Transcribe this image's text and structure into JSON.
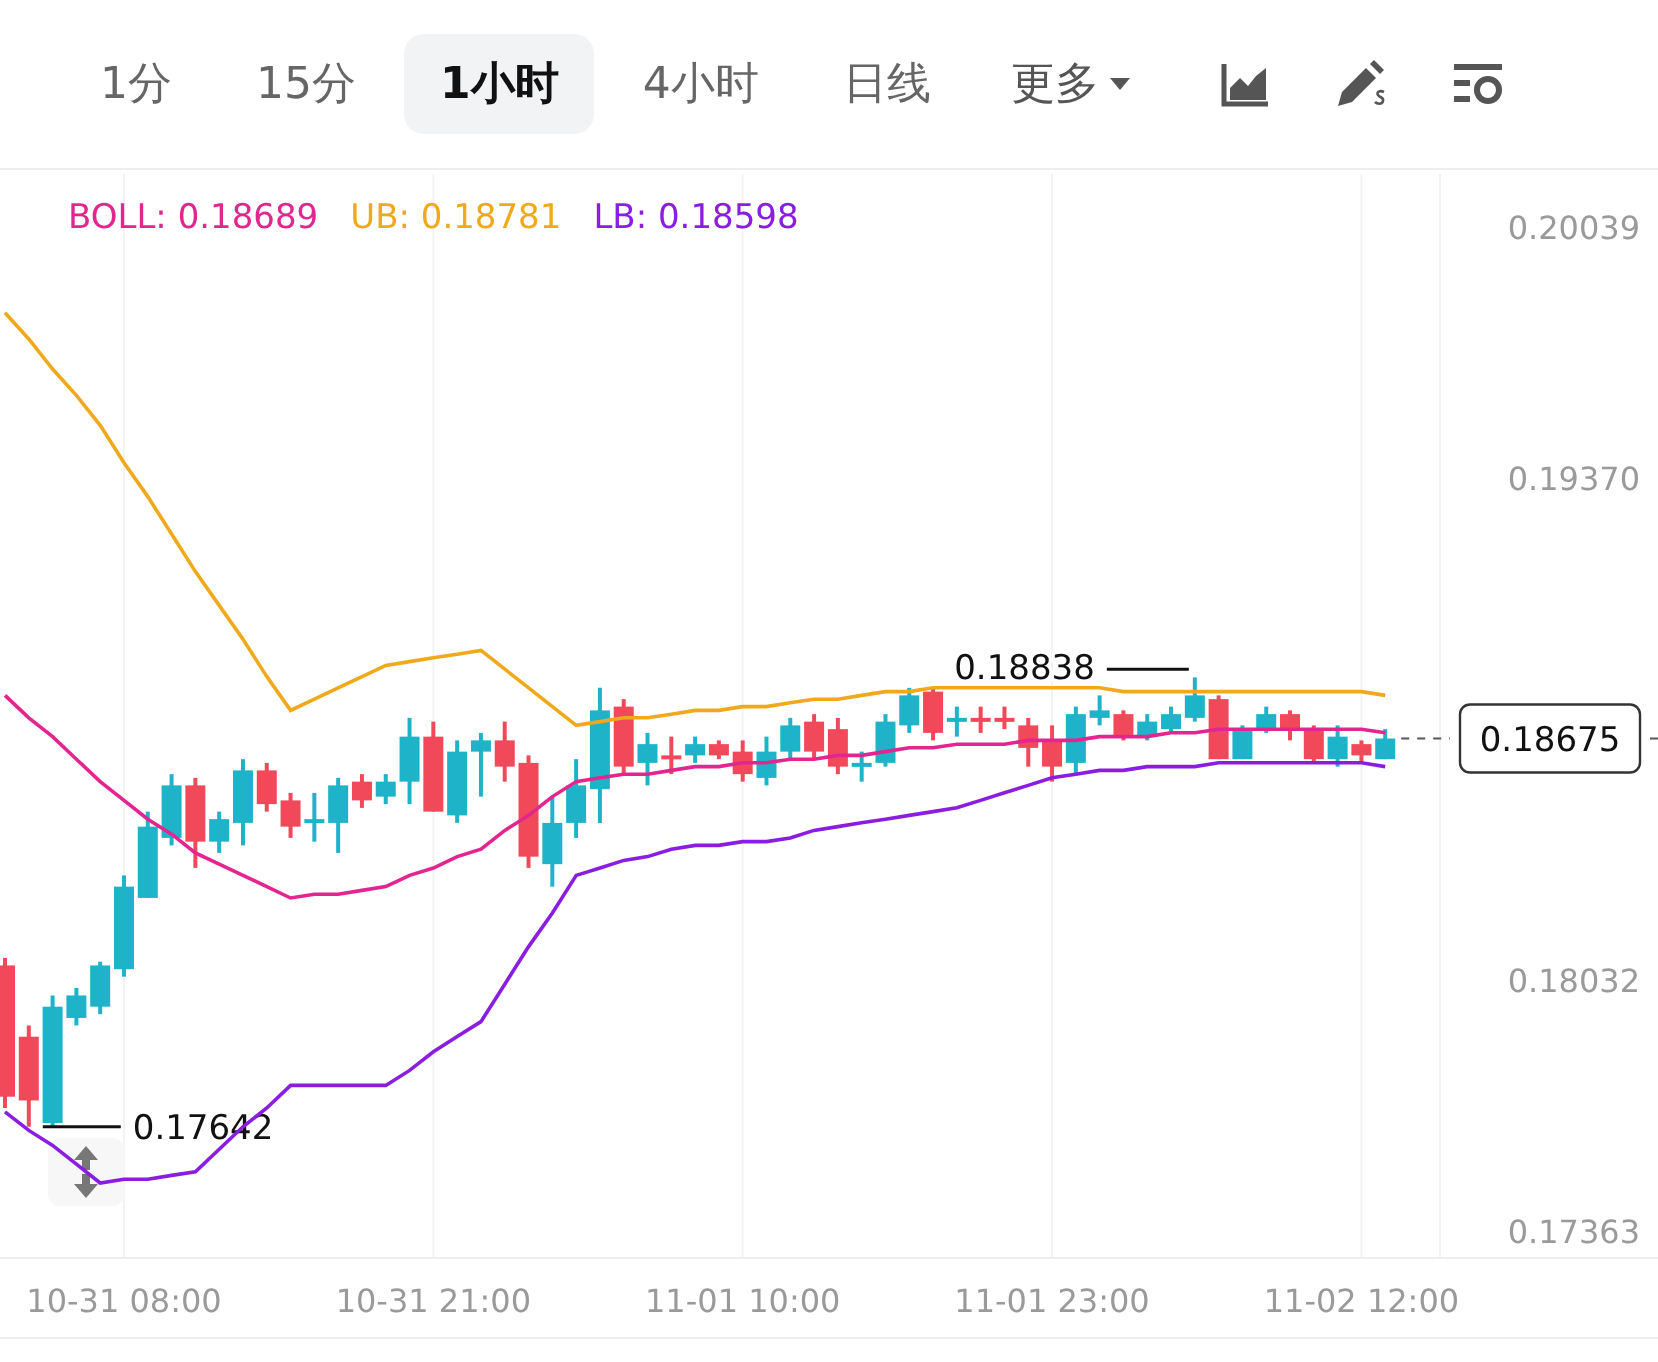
{
  "tabs": [
    {
      "label": "1分",
      "selected": false
    },
    {
      "label": "15分",
      "selected": false
    },
    {
      "label": "1小时",
      "selected": true
    },
    {
      "label": "4小时",
      "selected": false
    },
    {
      "label": "日线",
      "selected": false
    }
  ],
  "more": {
    "label": "更多"
  },
  "chart": {
    "legend": [
      {
        "value": "0.18689"
      },
      {
        "value": "0.18781"
      },
      {
        "value": "0.18598"
      }
    ],
    "chart_data": {
      "type": "candlestick",
      "categories": [
        null,
        null,
        null,
        null,
        null,
        "10-31 08:00",
        null,
        null,
        null,
        null,
        null,
        null,
        null,
        null,
        null,
        null,
        null,
        null,
        "10-31 21:00",
        null,
        null,
        null,
        null,
        null,
        null,
        null,
        null,
        null,
        null,
        null,
        null,
        "11-01 10:00",
        null,
        null,
        null,
        null,
        null,
        null,
        null,
        null,
        null,
        null,
        null,
        null,
        "11-01 23:00",
        null,
        null,
        null,
        null,
        null,
        null,
        null,
        null,
        null,
        null,
        null,
        null,
        "11-02 12:00",
        null
      ],
      "ylim": [
        0.1729,
        0.2018
      ],
      "grid": true,
      "yticks": [
        {
          "value": 0.20039,
          "label": "0.20039"
        },
        {
          "value": 0.1937,
          "label": "0.19370"
        },
        {
          "value": 0.18032,
          "label": "0.18032"
        },
        {
          "value": 0.17363,
          "label": "0.17363"
        }
      ],
      "ohlc": [
        [
          0.1807,
          0.1809,
          0.1769,
          0.1772
        ],
        [
          0.1788,
          0.1791,
          0.1764,
          0.1771
        ],
        [
          0.1765,
          0.1799,
          0.17642,
          0.1796
        ],
        [
          0.1793,
          0.1801,
          0.1791,
          0.1799
        ],
        [
          0.1796,
          0.1808,
          0.1794,
          0.1807
        ],
        [
          0.1806,
          0.1831,
          0.1804,
          0.1828
        ],
        [
          0.1825,
          0.1848,
          0.1825,
          0.1844
        ],
        [
          0.1841,
          0.1858,
          0.1839,
          0.1855
        ],
        [
          0.1855,
          0.1857,
          0.1833,
          0.184
        ],
        [
          0.184,
          0.1848,
          0.1837,
          0.1846
        ],
        [
          0.1845,
          0.1862,
          0.1839,
          0.1859
        ],
        [
          0.1859,
          0.1861,
          0.1848,
          0.185
        ],
        [
          0.1851,
          0.1853,
          0.1841,
          0.1844
        ],
        [
          0.1845,
          0.1853,
          0.184,
          0.1846
        ],
        [
          0.1845,
          0.1857,
          0.1837,
          0.1855
        ],
        [
          0.1856,
          0.1858,
          0.1849,
          0.1851
        ],
        [
          0.1852,
          0.1858,
          0.185,
          0.1856
        ],
        [
          0.1856,
          0.1873,
          0.185,
          0.1868
        ],
        [
          0.1868,
          0.1872,
          0.1848,
          0.1848
        ],
        [
          0.1847,
          0.1867,
          0.1845,
          0.1864
        ],
        [
          0.1864,
          0.1869,
          0.1852,
          0.1867
        ],
        [
          0.1867,
          0.1872,
          0.1856,
          0.186
        ],
        [
          0.1861,
          0.1863,
          0.1833,
          0.1836
        ],
        [
          0.1834,
          0.1852,
          0.1828,
          0.1845
        ],
        [
          0.1845,
          0.1862,
          0.1841,
          0.1855
        ],
        [
          0.1854,
          0.1881,
          0.1845,
          0.1875
        ],
        [
          0.1876,
          0.1878,
          0.1858,
          0.186
        ],
        [
          0.1861,
          0.1869,
          0.1855,
          0.1866
        ],
        [
          0.1863,
          0.1868,
          0.1858,
          0.1862
        ],
        [
          0.1863,
          0.1868,
          0.1861,
          0.1866
        ],
        [
          0.1866,
          0.1867,
          0.1862,
          0.1863
        ],
        [
          0.1864,
          0.1867,
          0.1856,
          0.1858
        ],
        [
          0.1857,
          0.1868,
          0.1855,
          0.1864
        ],
        [
          0.1864,
          0.1873,
          0.1862,
          0.1871
        ],
        [
          0.1872,
          0.1874,
          0.1862,
          0.1864
        ],
        [
          0.187,
          0.1873,
          0.1858,
          0.186
        ],
        [
          0.186,
          0.1864,
          0.1856,
          0.1861
        ],
        [
          0.1861,
          0.1874,
          0.186,
          0.1872
        ],
        [
          0.1871,
          0.1881,
          0.1869,
          0.1879
        ],
        [
          0.188,
          0.1881,
          0.1867,
          0.1869
        ],
        [
          0.1872,
          0.1876,
          0.1868,
          0.1873
        ],
        [
          0.1873,
          0.1876,
          0.1869,
          0.1872
        ],
        [
          0.1873,
          0.1876,
          0.187,
          0.1872
        ],
        [
          0.1871,
          0.1873,
          0.186,
          0.1865
        ],
        [
          0.1867,
          0.1871,
          0.1856,
          0.186
        ],
        [
          0.1861,
          0.1876,
          0.1858,
          0.1874
        ],
        [
          0.1873,
          0.1879,
          0.1871,
          0.1875
        ],
        [
          0.1874,
          0.1875,
          0.1867,
          0.1868
        ],
        [
          0.1868,
          0.1874,
          0.1867,
          0.1872
        ],
        [
          0.187,
          0.1876,
          0.1869,
          0.1874
        ],
        [
          0.1873,
          0.18838,
          0.1872,
          0.1879
        ],
        [
          0.1878,
          0.1879,
          0.1862,
          0.1862
        ],
        [
          0.1862,
          0.1871,
          0.1862,
          0.187
        ],
        [
          0.187,
          0.1876,
          0.1869,
          0.1874
        ],
        [
          0.1874,
          0.1875,
          0.1867,
          0.187
        ],
        [
          0.187,
          0.1871,
          0.1861,
          0.1862
        ],
        [
          0.1862,
          0.1871,
          0.186,
          0.1868
        ],
        [
          0.1866,
          0.1867,
          0.1861,
          0.1863
        ],
        [
          0.1862,
          0.187,
          0.1862,
          0.18675
        ]
      ],
      "series": [
        {
          "name": "BOLL:",
          "type": "line",
          "color": "#e3268f",
          "values": [
            0.1879,
            0.1873,
            0.1868,
            0.1862,
            0.1856,
            0.1851,
            0.1846,
            0.1842,
            0.1837,
            0.1834,
            0.1831,
            0.1828,
            0.1825,
            0.1826,
            0.1826,
            0.1827,
            0.1828,
            0.1831,
            0.1833,
            0.1836,
            0.1838,
            0.1843,
            0.1847,
            0.1852,
            0.1856,
            0.1857,
            0.1858,
            0.1858,
            0.1859,
            0.186,
            0.186,
            0.1861,
            0.1861,
            0.1862,
            0.1862,
            0.1863,
            0.1863,
            0.1864,
            0.1865,
            0.1865,
            0.1866,
            0.1866,
            0.1866,
            0.1867,
            0.1867,
            0.1867,
            0.1868,
            0.1868,
            0.1868,
            0.1869,
            0.1869,
            0.187,
            0.187,
            0.187,
            0.187,
            0.187,
            0.187,
            0.187,
            0.1869
          ]
        },
        {
          "name": "UB:",
          "type": "line",
          "color": "#f0a91c",
          "values": [
            0.1981,
            0.1974,
            0.1966,
            0.1959,
            0.1951,
            0.1941,
            0.1932,
            0.1922,
            0.1912,
            0.1903,
            0.1894,
            0.1884,
            0.1875,
            0.1878,
            0.1881,
            0.1884,
            0.1887,
            0.1888,
            0.1889,
            0.189,
            0.1891,
            0.1886,
            0.1881,
            0.1876,
            0.1871,
            0.1872,
            0.1873,
            0.1873,
            0.1874,
            0.1875,
            0.1875,
            0.1876,
            0.1876,
            0.1877,
            0.1878,
            0.1878,
            0.1879,
            0.188,
            0.188,
            0.1881,
            0.1881,
            0.1881,
            0.1881,
            0.1881,
            0.1881,
            0.1881,
            0.1881,
            0.188,
            0.188,
            0.188,
            0.188,
            0.188,
            0.188,
            0.188,
            0.188,
            0.188,
            0.188,
            0.188,
            0.1879
          ]
        },
        {
          "name": "LB:",
          "type": "line",
          "color": "#8a1de0",
          "values": [
            0.1768,
            0.1763,
            0.1759,
            0.1754,
            0.1749,
            0.175,
            0.175,
            0.1751,
            0.1752,
            0.1758,
            0.1764,
            0.1769,
            0.1775,
            0.1775,
            0.1775,
            0.1775,
            0.1775,
            0.1779,
            0.1784,
            0.1788,
            0.1792,
            0.1802,
            0.1812,
            0.1821,
            0.1831,
            0.1833,
            0.1835,
            0.1836,
            0.1838,
            0.1839,
            0.1839,
            0.184,
            0.184,
            0.1841,
            0.1843,
            0.1844,
            0.1845,
            0.1846,
            0.1847,
            0.1848,
            0.1849,
            0.1851,
            0.1853,
            0.1855,
            0.1857,
            0.1858,
            0.1859,
            0.1859,
            0.186,
            0.186,
            0.186,
            0.1861,
            0.1861,
            0.1861,
            0.1861,
            0.1861,
            0.1861,
            0.1861,
            0.186
          ]
        }
      ],
      "annotations": [
        "0.18838",
        "0.17642",
        "0.18675"
      ]
    }
  }
}
